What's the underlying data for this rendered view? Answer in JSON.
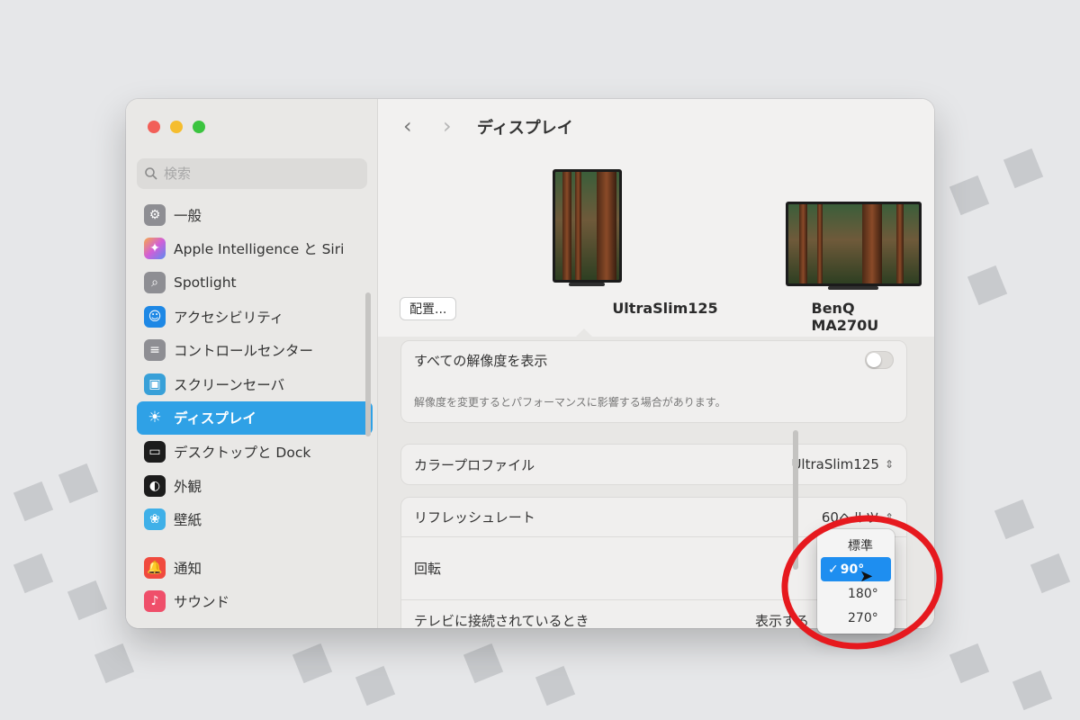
{
  "window": {
    "title": "ディスプレイ"
  },
  "sidebar": {
    "search_placeholder": "検索",
    "items": [
      {
        "label": "一般",
        "icon": "gear-icon",
        "color": "#8e8e93"
      },
      {
        "label": "Apple Intelligence と Siri",
        "icon": "siri-icon",
        "color": "#d15ed8"
      },
      {
        "label": "Spotlight",
        "icon": "magnifier-icon",
        "color": "#8e8e93"
      },
      {
        "label": "アクセシビリティ",
        "icon": "accessibility-icon",
        "color": "#1e88e5"
      },
      {
        "label": "コントロールセンター",
        "icon": "toggles-icon",
        "color": "#8e8e93"
      },
      {
        "label": "スクリーンセーバ",
        "icon": "screensaver-icon",
        "color": "#38a0d8"
      },
      {
        "label": "ディスプレイ",
        "icon": "sun-icon",
        "color": "#2fa1e6",
        "active": true
      },
      {
        "label": "デスクトップと Dock",
        "icon": "dock-icon",
        "color": "#1c1c1c"
      },
      {
        "label": "外観",
        "icon": "appearance-icon",
        "color": "#1c1c1c"
      },
      {
        "label": "壁紙",
        "icon": "flower-icon",
        "color": "#3fb0e8"
      },
      {
        "label": "通知",
        "icon": "bell-icon",
        "color": "#f04a3e"
      },
      {
        "label": "サウンド",
        "icon": "speaker-icon",
        "color": "#ef4f6a"
      }
    ]
  },
  "displays": {
    "arrange_label": "配置...",
    "monitors": [
      {
        "name": "UltraSlim125"
      },
      {
        "name": "BenQ MA270U"
      }
    ]
  },
  "settings": {
    "show_all_resolutions": {
      "label": "すべての解像度を表示",
      "note": "解像度を変更するとパフォーマンスに影響する場合があります。"
    },
    "color_profile": {
      "label": "カラープロファイル",
      "value": "UltraSlim125"
    },
    "refresh_rate": {
      "label": "リフレッシュレート",
      "value": "60ヘルツ"
    },
    "rotation": {
      "label": "回転"
    },
    "tv_connected": {
      "label": "テレビに接続されているとき",
      "value": "表示する"
    }
  },
  "rotation_menu": {
    "options": [
      "標準",
      "90°",
      "180°",
      "270°"
    ],
    "selected": "90°"
  },
  "accent_color": "#1e8ef0",
  "annotation_color": "#e6191e"
}
